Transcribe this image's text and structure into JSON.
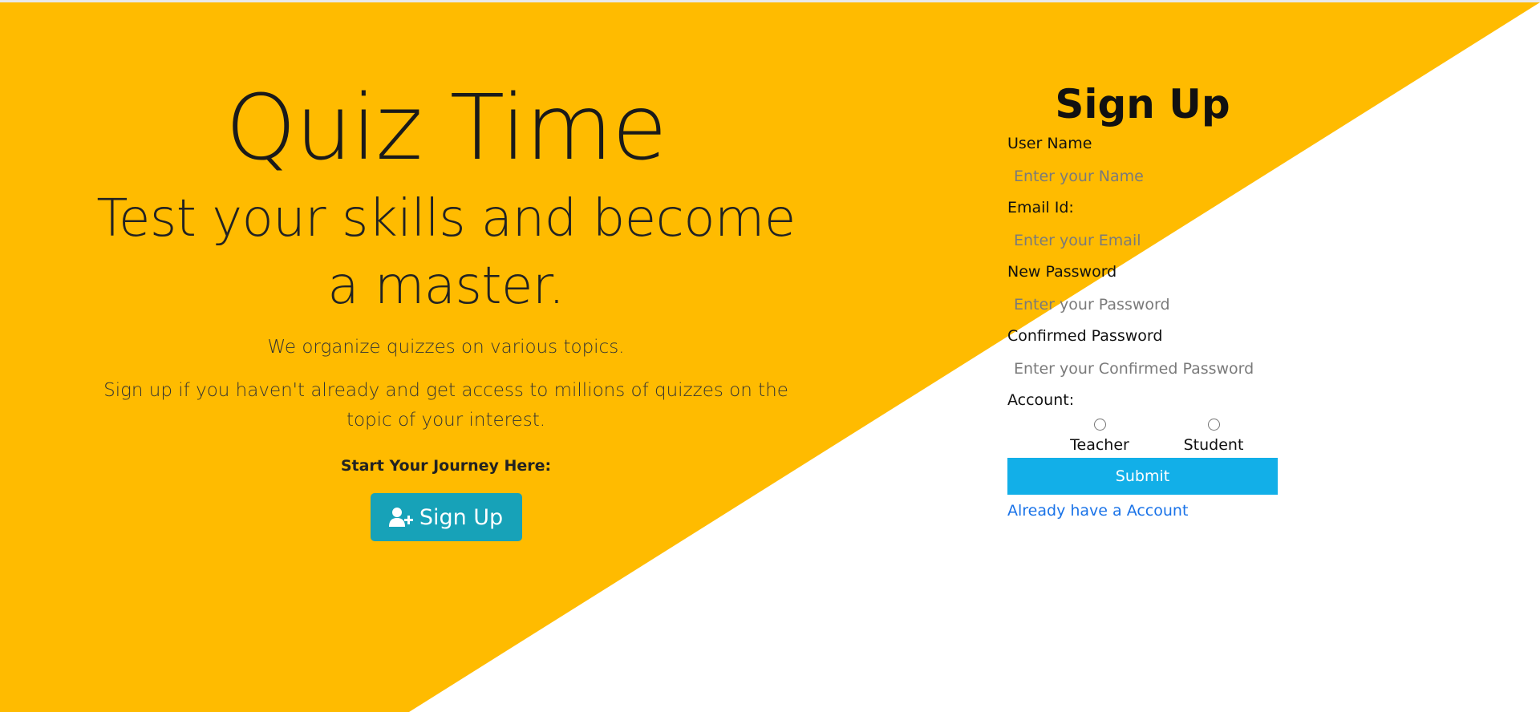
{
  "colors": {
    "accent": "#FFBB00",
    "hero_button": "#17A2B8",
    "submit_button": "#12AFE8",
    "link": "#1A73E8"
  },
  "hero": {
    "title": "Quiz Time",
    "subtitle": "Test your skills and become a master.",
    "lead": "We organize quizzes on various topics.",
    "lead_2": "Sign up if you haven't already and get access to millions of quizzes on the topic of your interest.",
    "journey_label": "Start Your Journey Here:",
    "signup_button": {
      "icon": "user-plus-icon",
      "label": "Sign Up"
    }
  },
  "signup_form": {
    "title": "Sign Up",
    "fields": [
      {
        "label": "User Name",
        "placeholder": "Enter your Name",
        "value": ""
      },
      {
        "label": "Email Id:",
        "placeholder": "Enter your Email",
        "value": ""
      },
      {
        "label": "New Password",
        "placeholder": "Enter your Password",
        "value": ""
      },
      {
        "label": "Confirmed Password",
        "placeholder": "Enter your Confirmed Password",
        "value": ""
      }
    ],
    "account": {
      "label": "Account:",
      "options": [
        "Teacher",
        "Student"
      ]
    },
    "submit_label": "Submit",
    "login_link": "Already have a Account"
  }
}
